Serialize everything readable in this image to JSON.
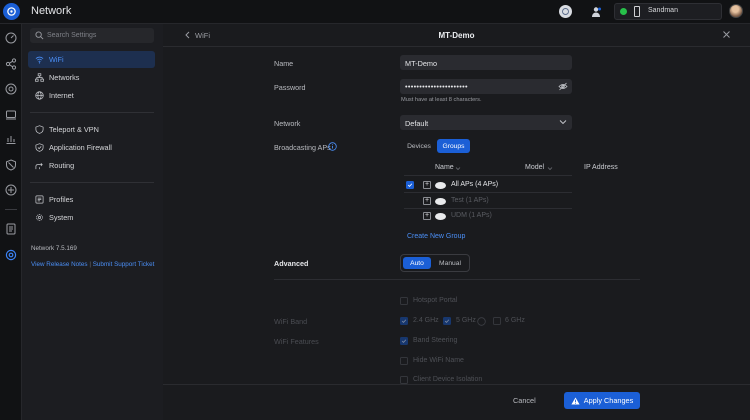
{
  "app": {
    "title": "Network",
    "user_name": "Sandman"
  },
  "search": {
    "placeholder": "Search Settings"
  },
  "sidebar": {
    "items": [
      {
        "label": "WiFi",
        "icon": "wifi-icon",
        "active": true
      },
      {
        "label": "Networks",
        "icon": "networks-icon"
      },
      {
        "label": "Internet",
        "icon": "globe-icon"
      },
      {
        "label": "Teleport & VPN",
        "icon": "shield-icon"
      },
      {
        "label": "Application Firewall",
        "icon": "firewall-icon"
      },
      {
        "label": "Routing",
        "icon": "routing-icon"
      },
      {
        "label": "Profiles",
        "icon": "profiles-icon"
      },
      {
        "label": "System",
        "icon": "gear-icon"
      }
    ],
    "version": "Network 7.5.169",
    "links": {
      "release_notes": "View Release Notes",
      "sep": "|",
      "support": "Submit Support Ticket"
    }
  },
  "panel": {
    "back_label": "WiFi",
    "title": "MT-Demo",
    "name_label": "Name",
    "name_value": "MT-Demo",
    "password_label": "Password",
    "password_value": "••••••••••••••••••••••",
    "password_hint": "Must have at least 8 characters.",
    "network_label": "Network",
    "network_value": "Default",
    "broadcasting_label": "Broadcasting APs",
    "tabs": {
      "devices": "Devices",
      "groups": "Groups"
    },
    "table": {
      "headers": {
        "name": "Name",
        "model": "Model",
        "ip": "IP Address"
      },
      "rows": [
        {
          "label": "All APs (4 APs)",
          "checked": true,
          "dim": false
        },
        {
          "label": "Test (1 APs)",
          "checked": false,
          "dim": true
        },
        {
          "label": "UDM (1 APs)",
          "checked": false,
          "dim": true
        }
      ]
    },
    "create_group": "Create New Group",
    "advanced_label": "Advanced",
    "advanced_modes": {
      "auto": "Auto",
      "manual": "Manual"
    },
    "hotspot_portal": "Hotspot Portal",
    "wifi_band_label": "WiFi Band",
    "bands": {
      "b24": "2.4 GHz",
      "b5": "5 GHz",
      "b6": "6 GHz"
    },
    "wifi_features_label": "WiFi Features",
    "band_steering": "Band Steering",
    "hide_wifi_name": "Hide WiFi Name",
    "client_isolation": "Client Device Isolation",
    "cancel": "Cancel",
    "apply": "Apply Changes"
  },
  "colors": {
    "accent": "#1b5fd6",
    "link": "#4b8ff6",
    "online": "#27c04a"
  }
}
